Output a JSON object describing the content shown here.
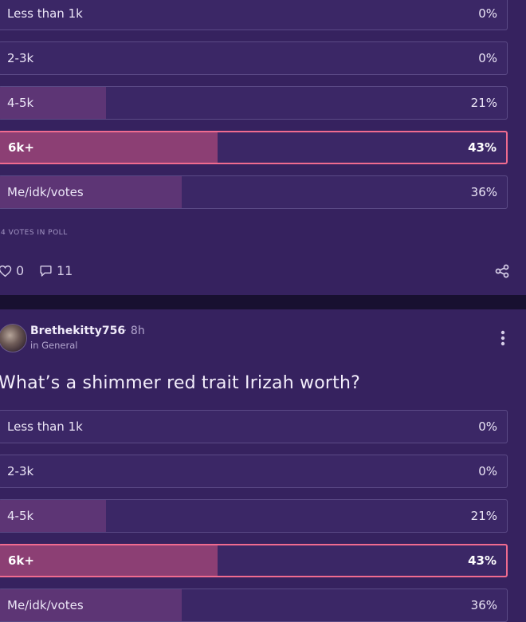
{
  "post1": {
    "options": [
      {
        "label": "Less than 1k",
        "percent": "0%",
        "share": 0
      },
      {
        "label": "2-3k",
        "percent": "0%",
        "share": 0
      },
      {
        "label": "4-5k",
        "percent": "21%",
        "share": 0.21
      },
      {
        "label": "6k+",
        "percent": "43%",
        "share": 0.43,
        "selected": true
      },
      {
        "label": "Me/idk/votes",
        "percent": "36%",
        "share": 0.36
      }
    ],
    "votes_label": "4 VOTES IN POLL",
    "likes": "0",
    "comments": "11"
  },
  "post2": {
    "author": "Brethekitty756",
    "separator": "·",
    "time": "8h",
    "category": "in General",
    "question": "What’s a shimmer red trait Irizah worth?",
    "options": [
      {
        "label": "Less than 1k",
        "percent": "0%",
        "share": 0
      },
      {
        "label": "2-3k",
        "percent": "0%",
        "share": 0
      },
      {
        "label": "4-5k",
        "percent": "21%",
        "share": 0.21
      },
      {
        "label": "6k+",
        "percent": "43%",
        "share": 0.43,
        "selected": true
      },
      {
        "label": "Me/idk/votes",
        "percent": "36%",
        "share": 0.36
      }
    ]
  },
  "icons": {
    "like": "heart-icon",
    "comment": "comment-bubble-icon",
    "share": "share-icon",
    "more": "more-vertical-icon"
  },
  "colors": {
    "background": "#36225f",
    "option_fill": "#5d3575",
    "selected_fill": "#8c3f74",
    "selected_border": "#f06b8f"
  }
}
